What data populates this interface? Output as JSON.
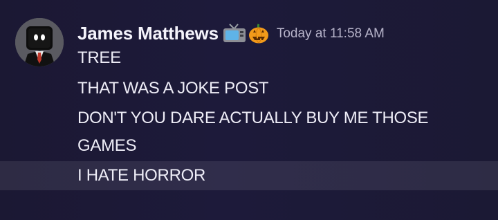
{
  "message": {
    "author": "James Matthews",
    "badges": [
      "tv-emoji",
      "jack-o-lantern-emoji"
    ],
    "timestamp": "Today at 11:58 AM",
    "lines": [
      "TREE",
      "THAT WAS A JOKE POST",
      "DON'T YOU DARE ACTUALLY BUY ME THOSE",
      "GAMES",
      "I HATE HORROR"
    ]
  },
  "colors": {
    "background": "#1c1936",
    "username": "#f4f3fb",
    "timestamp": "#b6b3c9",
    "text": "#eeedf7",
    "hover_row": "#2c2a42"
  }
}
